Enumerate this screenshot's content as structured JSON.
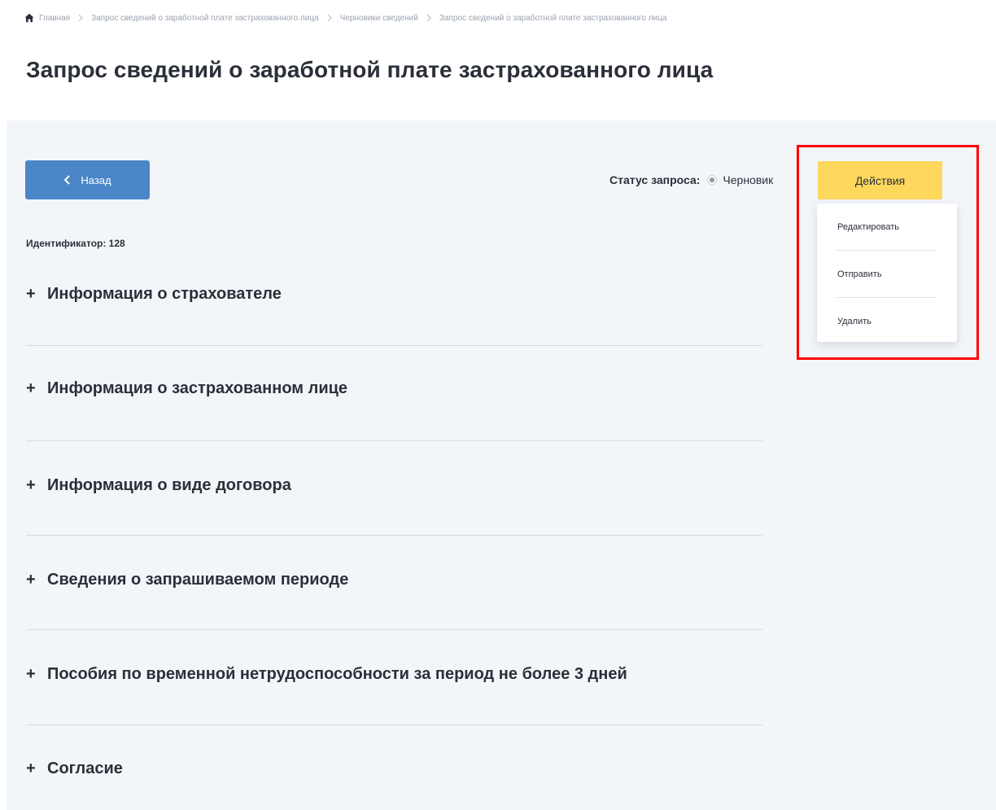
{
  "breadcrumb": {
    "items": [
      "Главная",
      "Запрос сведений о заработной плате застрахованного лица",
      "Черновики сведений",
      "Запрос сведений о заработной плате застрахованного лица"
    ]
  },
  "page": {
    "title": "Запрос сведений о заработной плате застрахованного лица"
  },
  "toolbar": {
    "back_label": "Назад",
    "status_label": "Статус запроса:",
    "status_value": "Черновик",
    "actions_label": "Действия"
  },
  "actions_menu": {
    "items": [
      "Редактировать",
      "Отправить",
      "Удалить"
    ]
  },
  "identifier": "Идентификатор: 128",
  "sections": [
    {
      "label": "Информация о страхователе"
    },
    {
      "label": "Информация о застрахованном лице"
    },
    {
      "label": "Информация о виде договора"
    },
    {
      "label": "Сведения о запрашиваемом периоде"
    },
    {
      "label": "Пособия по временной нетрудоспособности за период не более 3 дней"
    },
    {
      "label": "Согласие"
    }
  ],
  "colors": {
    "back_button": "#4a86c8",
    "actions_button": "#fdd85d",
    "highlight": "#ff0000",
    "panel_bg": "#f3f6f9"
  },
  "icons": {
    "home": "home-icon",
    "separator": "chevron-right-icon",
    "back": "chevron-left-icon",
    "expand": "plus-icon"
  }
}
